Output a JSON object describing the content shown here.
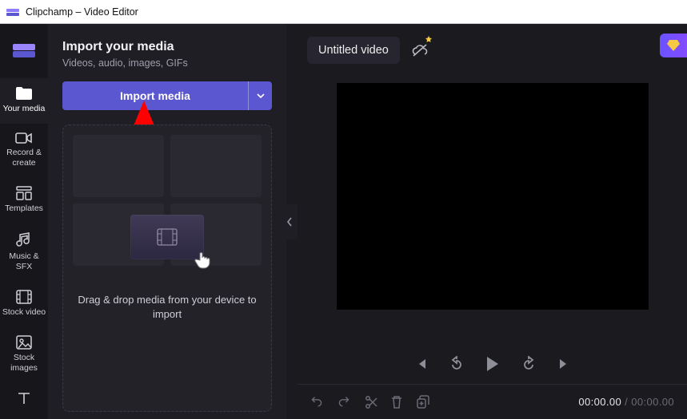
{
  "window": {
    "title": "Clipchamp – Video Editor"
  },
  "sidebar": {
    "items": [
      {
        "label": "Your media"
      },
      {
        "label": "Record & create"
      },
      {
        "label": "Templates"
      },
      {
        "label": "Music & SFX"
      },
      {
        "label": "Stock video"
      },
      {
        "label": "Stock images"
      }
    ]
  },
  "media_panel": {
    "heading": "Import your media",
    "subheading": "Videos, audio, images, GIFs",
    "import_label": "Import media",
    "dropzone_text": "Drag & drop media from your device to import"
  },
  "header": {
    "project_title": "Untitled video"
  },
  "time": {
    "current": "00:00.00",
    "total": "00:00.00"
  },
  "colors": {
    "accent": "#5b57d1",
    "panel": "#1f1e24",
    "app_bg": "#1b1a1f",
    "arrow": "#ff0000"
  }
}
